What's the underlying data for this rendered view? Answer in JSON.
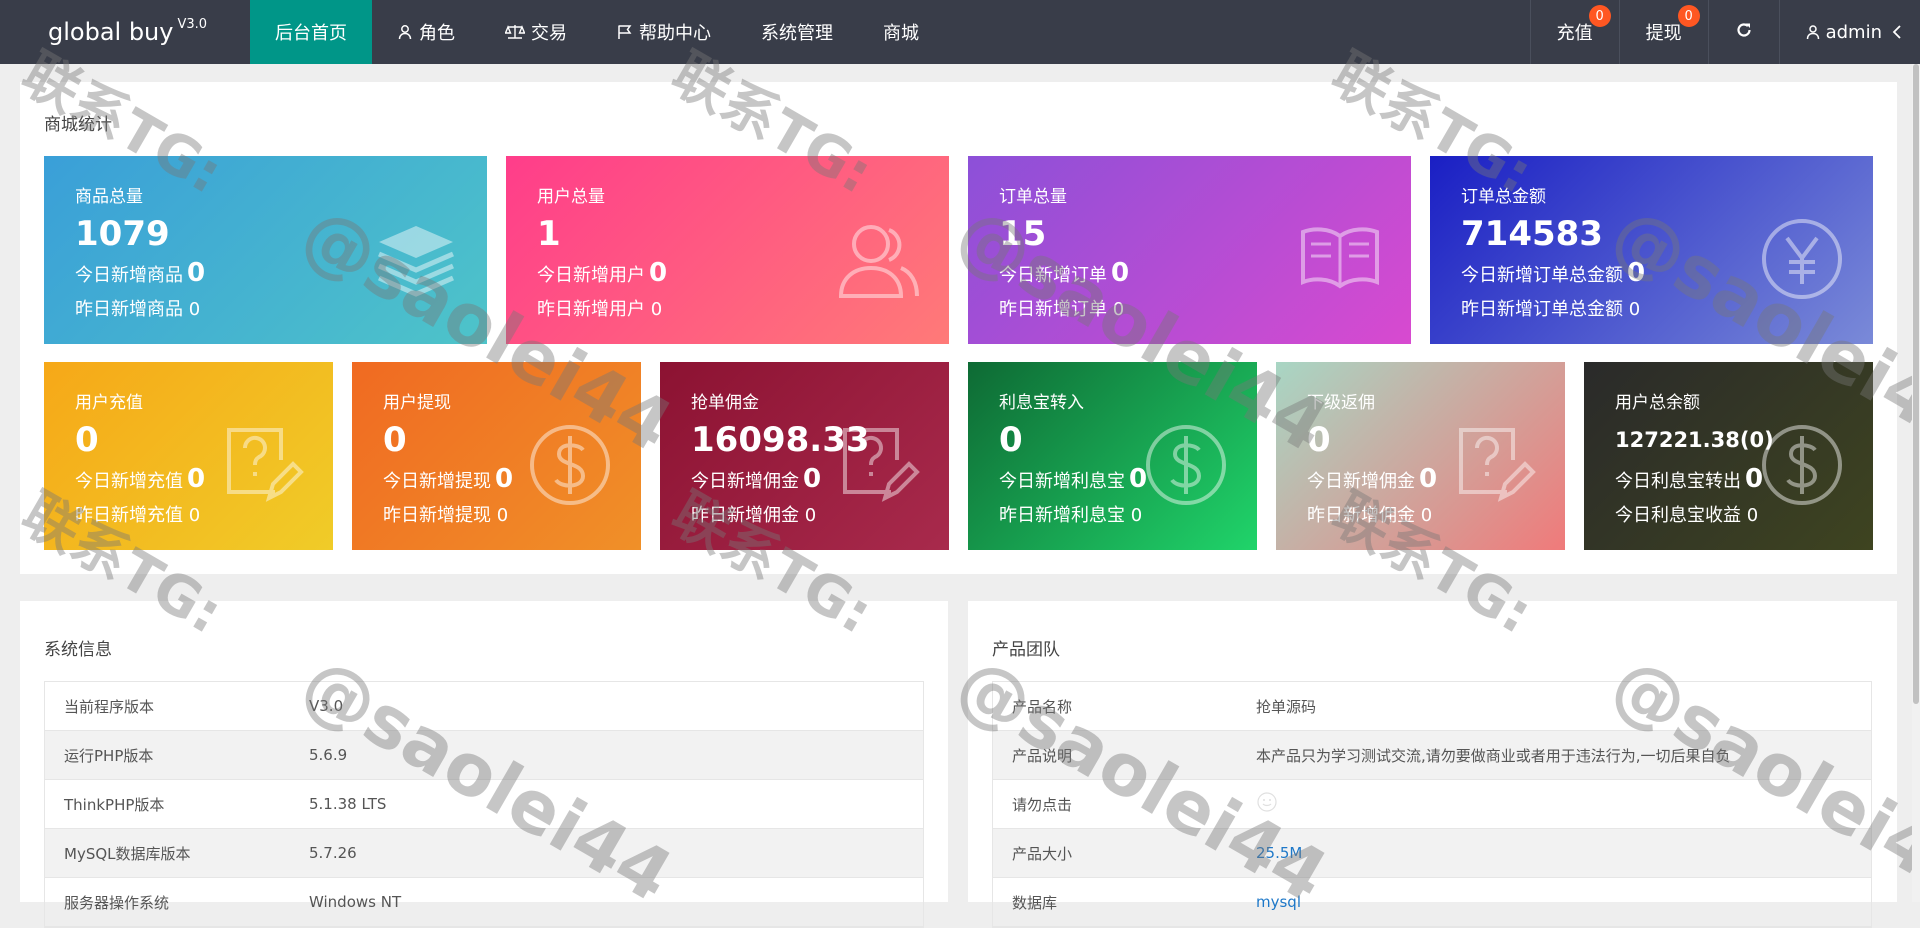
{
  "header": {
    "brand": "global buy",
    "version": "V3.0",
    "nav": [
      {
        "label": "后台首页",
        "icon": ""
      },
      {
        "label": "角色",
        "icon": "user-icon"
      },
      {
        "label": "交易",
        "icon": "scale-icon"
      },
      {
        "label": "帮助中心",
        "icon": "flag-icon"
      },
      {
        "label": "系统管理",
        "icon": ""
      },
      {
        "label": "商城",
        "icon": ""
      }
    ],
    "recharge": {
      "label": "充值",
      "count": "0"
    },
    "withdraw": {
      "label": "提现",
      "count": "0"
    },
    "refresh_icon": "refresh-icon",
    "user": "admin"
  },
  "stats": {
    "title": "商城统计",
    "row1": [
      {
        "title": "商品总量",
        "value": "1079",
        "today_label": "今日新增商品",
        "today_value": "0",
        "yest_label": "昨日新增商品",
        "yest_value": "0",
        "icon": "layers-icon"
      },
      {
        "title": "用户总量",
        "value": "1",
        "today_label": "今日新增用户",
        "today_value": "0",
        "yest_label": "昨日新增用户",
        "yest_value": "0",
        "icon": "users-icon"
      },
      {
        "title": "订单总量",
        "value": "15",
        "today_label": "今日新增订单",
        "today_value": "0",
        "yest_label": "昨日新增订单",
        "yest_value": "0",
        "icon": "book-icon"
      },
      {
        "title": "订单总金额",
        "value": "714583",
        "today_label": "今日新增订单总金额",
        "today_value": "0",
        "yest_label": "昨日新增订单总金额",
        "yest_value": "0",
        "icon": "yen-icon"
      }
    ],
    "row2": [
      {
        "title": "用户充值",
        "value": "0",
        "today_label": "今日新增充值",
        "today_value": "0",
        "yest_label": "昨日新增充值",
        "yest_value": "0",
        "icon": "question-edit-icon"
      },
      {
        "title": "用户提现",
        "value": "0",
        "today_label": "今日新增提现",
        "today_value": "0",
        "yest_label": "昨日新增提现",
        "yest_value": "0",
        "icon": "dollar-icon"
      },
      {
        "title": "抢单佣金",
        "value": "16098.33",
        "today_label": "今日新增佣金",
        "today_value": "0",
        "yest_label": "昨日新增佣金",
        "yest_value": "0",
        "icon": "question-edit-icon"
      },
      {
        "title": "利息宝转入",
        "value": "0",
        "today_label": "今日新增利息宝",
        "today_value": "0",
        "yest_label": "昨日新增利息宝",
        "yest_value": "0",
        "icon": "dollar-icon"
      },
      {
        "title": "下级返佣",
        "value": "0",
        "today_label": "今日新增佣金",
        "today_value": "0",
        "yest_label": "昨日新增佣金",
        "yest_value": "0",
        "icon": "question-edit-icon"
      },
      {
        "title": "用户总余额",
        "value": "127221.38(0)",
        "today_label": "今日利息宝转出",
        "today_value": "0",
        "yest_label": "今日利息宝收益",
        "yest_value": "0",
        "icon": "dollar-icon"
      }
    ]
  },
  "system": {
    "title": "系统信息",
    "rows": [
      {
        "k": "当前程序版本",
        "v": "V3.0"
      },
      {
        "k": "运行PHP版本",
        "v": "5.6.9"
      },
      {
        "k": "ThinkPHP版本",
        "v": "5.1.38 LTS"
      },
      {
        "k": "MySQL数据库版本",
        "v": "5.7.26"
      },
      {
        "k": "服务器操作系统",
        "v": "Windows NT"
      }
    ]
  },
  "team": {
    "title": "产品团队",
    "rows": [
      {
        "k": "产品名称",
        "v": "抢单源码"
      },
      {
        "k": "产品说明",
        "v": "本产品只为学习测试交流,请勿要做商业或者用于违法行为,一切后果自负"
      },
      {
        "k": "请勿点击",
        "v": ""
      },
      {
        "k": "产品大小",
        "v": "25.5M"
      },
      {
        "k": "数据库",
        "v": "mysql"
      }
    ]
  },
  "watermark": {
    "line1": "联系TG:",
    "line2": "@saolei44"
  }
}
